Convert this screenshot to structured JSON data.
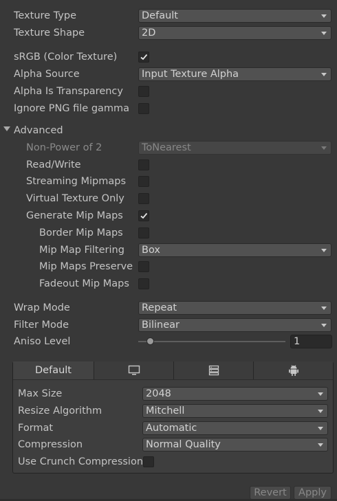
{
  "texture_type": {
    "label": "Texture Type",
    "value": "Default"
  },
  "texture_shape": {
    "label": "Texture Shape",
    "value": "2D"
  },
  "srgb": {
    "label": "sRGB (Color Texture)",
    "checked": true
  },
  "alpha_source": {
    "label": "Alpha Source",
    "value": "Input Texture Alpha"
  },
  "alpha_is_transparency": {
    "label": "Alpha Is Transparency",
    "checked": false
  },
  "ignore_png_gamma": {
    "label": "Ignore PNG file gamma",
    "checked": false
  },
  "advanced": {
    "label": "Advanced",
    "non_power_of_2": {
      "label": "Non-Power of 2",
      "value": "ToNearest"
    },
    "read_write": {
      "label": "Read/Write",
      "checked": false
    },
    "streaming_mipmaps": {
      "label": "Streaming Mipmaps",
      "checked": false
    },
    "virtual_texture_only": {
      "label": "Virtual Texture Only",
      "checked": false
    },
    "generate_mip_maps": {
      "label": "Generate Mip Maps",
      "checked": true
    },
    "border_mip_maps": {
      "label": "Border Mip Maps",
      "checked": false
    },
    "mip_map_filtering": {
      "label": "Mip Map Filtering",
      "value": "Box"
    },
    "mip_maps_preserve": {
      "label": "Mip Maps Preserve",
      "checked": false
    },
    "fadeout_mip_maps": {
      "label": "Fadeout Mip Maps",
      "checked": false
    }
  },
  "wrap_mode": {
    "label": "Wrap Mode",
    "value": "Repeat"
  },
  "filter_mode": {
    "label": "Filter Mode",
    "value": "Bilinear"
  },
  "aniso_level": {
    "label": "Aniso Level",
    "value": "1",
    "slider_fraction": 0.08
  },
  "platform_tabs": [
    {
      "label": "Default",
      "icon": null,
      "active": true
    },
    {
      "label": "",
      "icon": "monitor-icon",
      "active": false
    },
    {
      "label": "",
      "icon": "server-icon",
      "active": false
    },
    {
      "label": "",
      "icon": "android-icon",
      "active": false
    }
  ],
  "platform": {
    "max_size": {
      "label": "Max Size",
      "value": "2048"
    },
    "resize_algorithm": {
      "label": "Resize Algorithm",
      "value": "Mitchell"
    },
    "format": {
      "label": "Format",
      "value": "Automatic"
    },
    "compression": {
      "label": "Compression",
      "value": "Normal Quality"
    },
    "use_crunch": {
      "label": "Use Crunch Compression",
      "checked": false
    }
  },
  "buttons": {
    "revert": "Revert",
    "apply": "Apply"
  }
}
